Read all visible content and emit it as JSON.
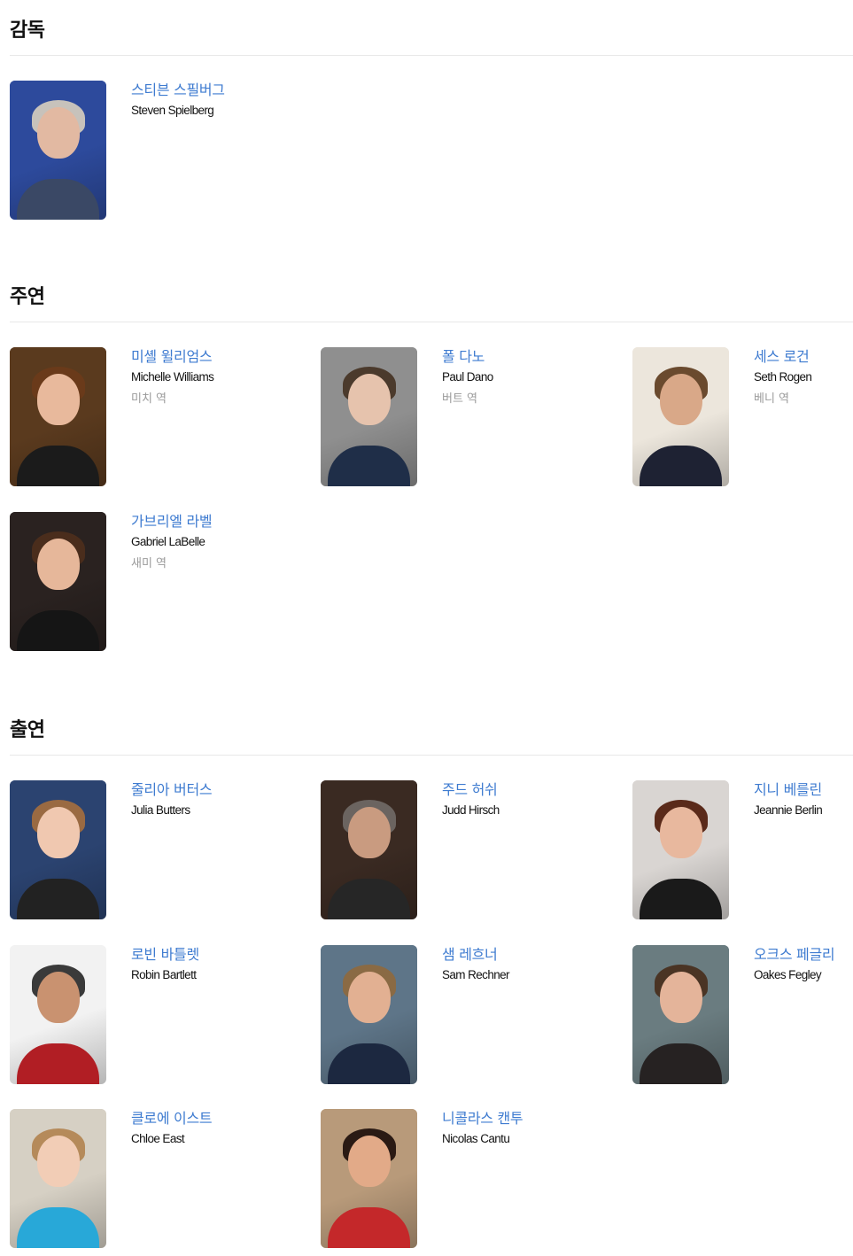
{
  "sections": {
    "director": {
      "title": "감독",
      "people": [
        {
          "kname": "스티븐 스필버그",
          "ename": "Steven Spielberg",
          "role": "",
          "bg": "#2d4a9c",
          "skin": "#e2b9a2",
          "hair": "#c7c2bb",
          "shirt": "#3a4865"
        }
      ]
    },
    "lead": {
      "title": "주연",
      "people": [
        {
          "kname": "미셸 윌리엄스",
          "ename": "Michelle Williams",
          "role": "미치 역",
          "bg": "#5a3a1e",
          "skin": "#e8b99c",
          "hair": "#6a3a1a",
          "shirt": "#1b1b1b"
        },
        {
          "kname": "폴 다노",
          "ename": "Paul Dano",
          "role": "버트 역",
          "bg": "#8f8f8f",
          "skin": "#e6c3ad",
          "hair": "#4b3a2c",
          "shirt": "#1f2e48"
        },
        {
          "kname": "세스 로건",
          "ename": "Seth Rogen",
          "role": "베니 역",
          "bg": "#ece6dc",
          "skin": "#d9a888",
          "hair": "#6a4a2e",
          "shirt": "#1e2233"
        },
        {
          "kname": "가브리엘 라벨",
          "ename": "Gabriel LaBelle",
          "role": "새미 역",
          "bg": "#2a2220",
          "skin": "#e6b79a",
          "hair": "#4a2d1c",
          "shirt": "#151515"
        }
      ]
    },
    "cast": {
      "title": "출연",
      "people": [
        {
          "kname": "줄리아 버터스",
          "ename": "Julia Butters",
          "role": "",
          "bg": "#2b4370",
          "skin": "#f0c8b0",
          "hair": "#9a6a42",
          "shirt": "#222222"
        },
        {
          "kname": "주드 허쉬",
          "ename": "Judd Hirsch",
          "role": "",
          "bg": "#3a2a22",
          "skin": "#c99b80",
          "hair": "#6b6460",
          "shirt": "#262626"
        },
        {
          "kname": "지니 베를린",
          "ename": "Jeannie Berlin",
          "role": "",
          "bg": "#d9d5d2",
          "skin": "#e8b89e",
          "hair": "#5a2a1a",
          "shirt": "#1a1a1a"
        },
        {
          "kname": "로빈 바틀렛",
          "ename": "Robin Bartlett",
          "role": "",
          "bg": "#f2f2f2",
          "skin": "#c99270",
          "hair": "#3a3a3a",
          "shirt": "#b11e24"
        },
        {
          "kname": "샘 레흐너",
          "ename": "Sam Rechner",
          "role": "",
          "bg": "#5e7588",
          "skin": "#e2b092",
          "hair": "#8a6a44",
          "shirt": "#1c2840"
        },
        {
          "kname": "오크스 페글리",
          "ename": "Oakes Fegley",
          "role": "",
          "bg": "#6a7c80",
          "skin": "#e4b49a",
          "hair": "#4a3424",
          "shirt": "#262222"
        },
        {
          "kname": "클로에 이스트",
          "ename": "Chloe East",
          "role": "",
          "bg": "#d6d0c4",
          "skin": "#f2cdb6",
          "hair": "#b58a5a",
          "shirt": "#28a8d8"
        },
        {
          "kname": "니콜라스 캔투",
          "ename": "Nicolas Cantu",
          "role": "",
          "bg": "#b89a7a",
          "skin": "#e2aa88",
          "hair": "#2a1a14",
          "shirt": "#c4282a"
        }
      ]
    }
  }
}
